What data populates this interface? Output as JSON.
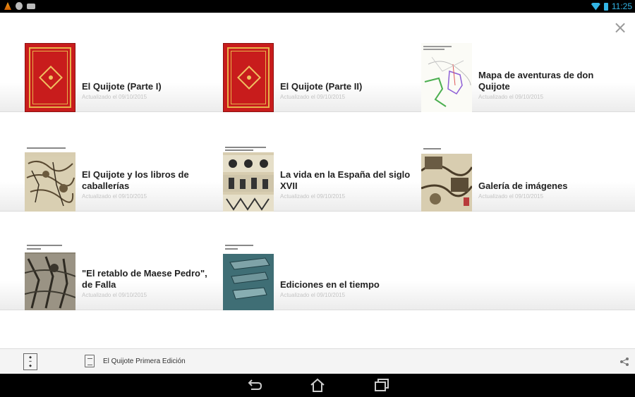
{
  "status_bar": {
    "time": "11:25"
  },
  "items": [
    {
      "title": "El Quijote (Parte I)",
      "subtitle": "Actualizado el 09/10/2015",
      "cover": "red-book"
    },
    {
      "title": "El Quijote (Parte II)",
      "subtitle": "Actualizado el 09/10/2015",
      "cover": "red-book"
    },
    {
      "title": "Mapa de aventuras de don Quijote",
      "subtitle": "Actualizado el 09/10/2015",
      "cover": "map"
    },
    {
      "title": "El Quijote y los libros de caballerías",
      "subtitle": "Actualizado el 09/10/2015",
      "cover": "engraving"
    },
    {
      "title": "La vida en la España del siglo XVII",
      "subtitle": "Actualizado el 09/10/2015",
      "cover": "engraving-panels"
    },
    {
      "title": "Galería de imágenes",
      "subtitle": "Actualizado el 09/10/2015",
      "cover": "engraving-collage"
    },
    {
      "title": "\"El retablo de Maese Pedro\", de Falla",
      "subtitle": "Actualizado el 09/10/2015",
      "cover": "engraving-dark"
    },
    {
      "title": "Ediciones en el tiempo",
      "subtitle": "Actualizado el 09/10/2015",
      "cover": "teal-books"
    }
  ],
  "bottom_bar": {
    "document_title": "El Quijote Primera Edición"
  },
  "icons": {
    "close": "close-icon",
    "share": "share-icon",
    "back": "back-icon",
    "home": "home-icon",
    "recents": "recents-icon"
  }
}
